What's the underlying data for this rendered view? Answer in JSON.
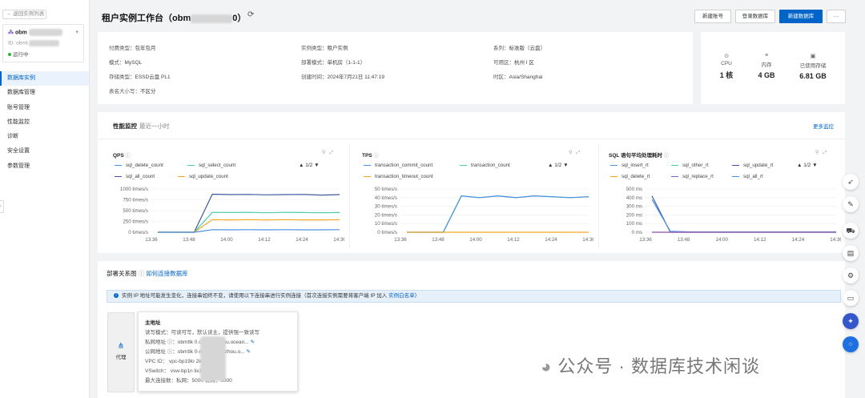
{
  "sidebar": {
    "back_label": "返回实例列表",
    "instance_name": "obm",
    "instance_id_label": "ID: obmt",
    "status": "运行中",
    "nav": [
      "数据库实例",
      "数据库管理",
      "账号管理",
      "性能监控",
      "诊断",
      "安全设置",
      "参数管理"
    ]
  },
  "header": {
    "title_prefix": "租户实例工作台（obm",
    "title_suffix": "0）",
    "buttons": [
      "新建账号",
      "登录数据库",
      "新建数据库",
      "···"
    ]
  },
  "info": {
    "pay_type": {
      "k": "付费类型：",
      "v": "包年包月"
    },
    "instance_type": {
      "k": "实例类型：",
      "v": "租户实例"
    },
    "series": {
      "k": "系列：",
      "v": "标准版（云盘）"
    },
    "mode": {
      "k": "模式：",
      "v": "MySQL"
    },
    "deploy_mode": {
      "k": "部署模式：",
      "v": "单机房（1-1-1）"
    },
    "zone": {
      "k": "可用区：",
      "v": "杭州 I 区"
    },
    "storage_type": {
      "k": "存储类型：",
      "v": "ESSD云盘 PL1"
    },
    "created": {
      "k": "创建时间：",
      "v": "2024年7月21日 11:47:19"
    },
    "timezone": {
      "k": "时区：",
      "v": "Asia/Shanghai"
    },
    "case": {
      "k": "表名大小写：",
      "v": "不区分"
    }
  },
  "resources": [
    {
      "icon": "cpu-icon",
      "label": "CPU",
      "value": "1 核"
    },
    {
      "icon": "memory-icon",
      "label": "内存",
      "value": "4 GB"
    },
    {
      "icon": "storage-icon",
      "label": "已使用存储",
      "value": "6.81 GB"
    }
  ],
  "monitor": {
    "title": "性能监控",
    "subtitle": "最近一小时",
    "more": "更多监控"
  },
  "charts_legend": {
    "qps": [
      "sql_delete_count",
      "sql_select_count",
      "sql_all_count",
      "sql_update_count"
    ],
    "tps": [
      "transaction_commit_count",
      "transaction_count",
      "transaction_timeout_count"
    ],
    "sql": [
      "sql_insert_rt",
      "sql_other_rt",
      "sql_update_rt",
      "sql_delete_rt",
      "sql_replace_rt",
      "sql_all_rt"
    ],
    "pager": "1/2"
  },
  "chart_data": [
    {
      "type": "line",
      "title": "QPS",
      "x": [
        "13:36",
        "13:48",
        "14:00",
        "14:12",
        "14:24",
        "14:36"
      ],
      "yticks": [
        "0 times/s",
        "250 times/s",
        "500 times/s",
        "750 times/s",
        "1000 times/s"
      ],
      "ylim": [
        0,
        1000
      ],
      "series": [
        {
          "name": "sql_all_count",
          "color": "#3d5a9e",
          "values": [
            0,
            0,
            0,
            880,
            870,
            875,
            865,
            870,
            875,
            860,
            870
          ]
        },
        {
          "name": "sql_select_count",
          "color": "#4ecba6",
          "values": [
            0,
            0,
            0,
            460,
            455,
            460,
            450,
            460,
            455,
            450,
            455
          ]
        },
        {
          "name": "sql_update_count",
          "color": "#f5a623",
          "values": [
            0,
            0,
            0,
            290,
            285,
            290,
            285,
            290,
            285,
            285,
            290
          ]
        },
        {
          "name": "sql_delete_count",
          "color": "#4a90e2",
          "values": [
            0,
            0,
            0,
            60,
            55,
            60,
            55,
            60,
            55,
            55,
            60
          ]
        }
      ]
    },
    {
      "type": "line",
      "title": "TPS",
      "x": [
        "13:36",
        "13:48",
        "14:00",
        "14:12",
        "14:24",
        "14:36"
      ],
      "yticks": [
        "0 times/s",
        "10 times/s",
        "20 times/s",
        "30 times/s",
        "40 times/s",
        "50 times/s"
      ],
      "ylim": [
        0,
        50
      ],
      "series": [
        {
          "name": "transaction_count",
          "color": "#4ecba6",
          "values": [
            0,
            0,
            0,
            42,
            40,
            42,
            40,
            42,
            41,
            40,
            41
          ]
        },
        {
          "name": "transaction_commit_count",
          "color": "#4a90e2",
          "values": [
            0,
            0,
            0,
            42,
            40,
            42,
            40,
            42,
            41,
            40,
            41
          ]
        },
        {
          "name": "transaction_timeout_count",
          "color": "#f5a623",
          "values": [
            0,
            0,
            0,
            0,
            0,
            0,
            0,
            0,
            0,
            0,
            0
          ]
        }
      ]
    },
    {
      "type": "line",
      "title": "SQL 语句平均处理耗时",
      "x": [
        "13:36",
        "13:48",
        "14:00",
        "14:12",
        "14:24",
        "14:36"
      ],
      "yticks": [
        "0 ms",
        "100 ms",
        "200 ms",
        "300 ms",
        "400 ms",
        "500 ms"
      ],
      "ylim": [
        0,
        500
      ],
      "series": [
        {
          "name": "sql_update_rt",
          "color": "#3d5a9e",
          "values": [
            420,
            0,
            0,
            0,
            0,
            0,
            0,
            0,
            0,
            0,
            0
          ]
        },
        {
          "name": "sql_all_rt",
          "color": "#4a90e2",
          "values": [
            380,
            10,
            5,
            5,
            5,
            5,
            5,
            5,
            5,
            5,
            5
          ]
        },
        {
          "name": "sql_delete_rt",
          "color": "#f5a623",
          "values": [
            0,
            0,
            0,
            0,
            0,
            0,
            0,
            0,
            0,
            0,
            0
          ]
        },
        {
          "name": "sql_replace_rt",
          "color": "#8a5cc7",
          "values": [
            0,
            0,
            0,
            0,
            0,
            0,
            0,
            0,
            0,
            0,
            0
          ]
        }
      ]
    }
  ],
  "deploy": {
    "title": "部署关系图",
    "how": "如何连接数据库",
    "notice": "实例 IP 地址可能发生变化，连接串如终不变，请使用以下连接串进行实例连接（首次连接实例需要将客户端 IP 加入 ",
    "notice_link": "实例白名单",
    "notice_end": "）",
    "proxy": "代理",
    "main": "主地址",
    "rows": [
      "读写模式：可读可写，默认读主，提供强一致读写",
      "私网地址 ⓘ：obmtlk          0.cn-hangzhou.ocean...",
      "公网地址 ⓘ：obmtlk          0-mi.cn-hangzhou.o...",
      "VPC ID： vpc-bp19lo               2kb7",
      "VSwitch： vsw-bp1n               lix3qb",
      "最大连接数：私网：5000        公网：5000"
    ]
  },
  "watermark": "公众号 · 数据库技术闲谈"
}
